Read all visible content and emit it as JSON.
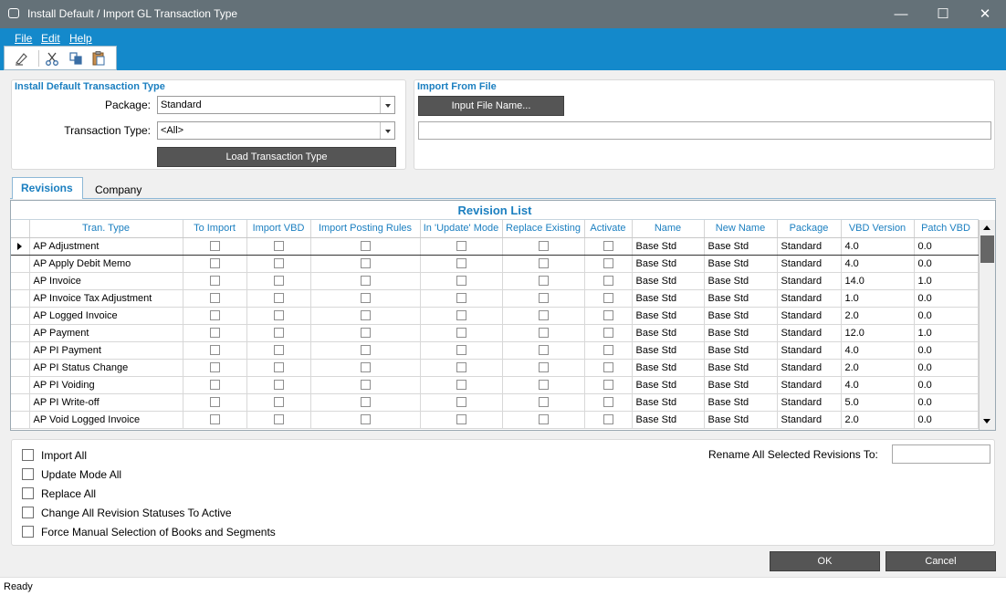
{
  "window": {
    "title": "Install Default / Import GL Transaction Type",
    "minimize": "—",
    "maximize": "☐",
    "close": "✕"
  },
  "menu": [
    {
      "label": "File"
    },
    {
      "label": "Edit"
    },
    {
      "label": "Help"
    }
  ],
  "toolbar_icons": [
    "eraser-icon",
    "cut-icon",
    "copy-icon",
    "paste-icon"
  ],
  "install_panel": {
    "title": "Install Default Transaction Type",
    "package_label": "Package:",
    "package_value": "Standard",
    "transaction_type_label": "Transaction Type:",
    "transaction_type_value": "<All>",
    "load_button": "Load Transaction Type"
  },
  "import_panel": {
    "title": "Import From File",
    "input_button": "Input File Name...",
    "file_path": ""
  },
  "tabs": [
    {
      "label": "Revisions",
      "active": true
    },
    {
      "label": "Company",
      "active": false
    }
  ],
  "grid": {
    "caption": "Revision List",
    "columns": [
      "Tran. Type",
      "To Import",
      "Import VBD",
      "Import Posting Rules",
      "In 'Update' Mode",
      "Replace Existing",
      "Activate",
      "Name",
      "New Name",
      "Package",
      "VBD Version",
      "Patch VBD"
    ],
    "rows": [
      {
        "tran_type": "AP Adjustment",
        "name": "Base Std",
        "new_name": "Base Std",
        "package": "Standard",
        "vbd_version": "4.0",
        "patch_vbd": "0.0",
        "selected": true
      },
      {
        "tran_type": "AP Apply Debit Memo",
        "name": "Base Std",
        "new_name": "Base Std",
        "package": "Standard",
        "vbd_version": "4.0",
        "patch_vbd": "0.0"
      },
      {
        "tran_type": "AP Invoice",
        "name": "Base Std",
        "new_name": "Base Std",
        "package": "Standard",
        "vbd_version": "14.0",
        "patch_vbd": "1.0"
      },
      {
        "tran_type": "AP Invoice Tax Adjustment",
        "name": "Base Std",
        "new_name": "Base Std",
        "package": "Standard",
        "vbd_version": "1.0",
        "patch_vbd": "0.0"
      },
      {
        "tran_type": "AP Logged Invoice",
        "name": "Base Std",
        "new_name": "Base Std",
        "package": "Standard",
        "vbd_version": "2.0",
        "patch_vbd": "0.0"
      },
      {
        "tran_type": "AP Payment",
        "name": "Base Std",
        "new_name": "Base Std",
        "package": "Standard",
        "vbd_version": "12.0",
        "patch_vbd": "1.0"
      },
      {
        "tran_type": "AP PI Payment",
        "name": "Base Std",
        "new_name": "Base Std",
        "package": "Standard",
        "vbd_version": "4.0",
        "patch_vbd": "0.0"
      },
      {
        "tran_type": "AP PI Status Change",
        "name": "Base Std",
        "new_name": "Base Std",
        "package": "Standard",
        "vbd_version": "2.0",
        "patch_vbd": "0.0"
      },
      {
        "tran_type": "AP PI Voiding",
        "name": "Base Std",
        "new_name": "Base Std",
        "package": "Standard",
        "vbd_version": "4.0",
        "patch_vbd": "0.0"
      },
      {
        "tran_type": "AP PI Write-off",
        "name": "Base Std",
        "new_name": "Base Std",
        "package": "Standard",
        "vbd_version": "5.0",
        "patch_vbd": "0.0"
      },
      {
        "tran_type": "AP Void Logged Invoice",
        "name": "Base Std",
        "new_name": "Base Std",
        "package": "Standard",
        "vbd_version": "2.0",
        "patch_vbd": "0.0"
      }
    ]
  },
  "options": [
    {
      "label": "Import All"
    },
    {
      "label": "Update Mode All"
    },
    {
      "label": "Replace All"
    },
    {
      "label": "Change All Revision Statuses To Active"
    },
    {
      "label": "Force Manual Selection of Books and Segments"
    }
  ],
  "rename": {
    "label": "Rename All Selected Revisions To:",
    "value": ""
  },
  "buttons": {
    "ok": "OK",
    "cancel": "Cancel"
  },
  "status": "Ready",
  "colors": {
    "titlebar": "#647178",
    "ribbon": "#1489cb",
    "accent_text": "#1b7fc0",
    "dark_button": "#555555"
  }
}
